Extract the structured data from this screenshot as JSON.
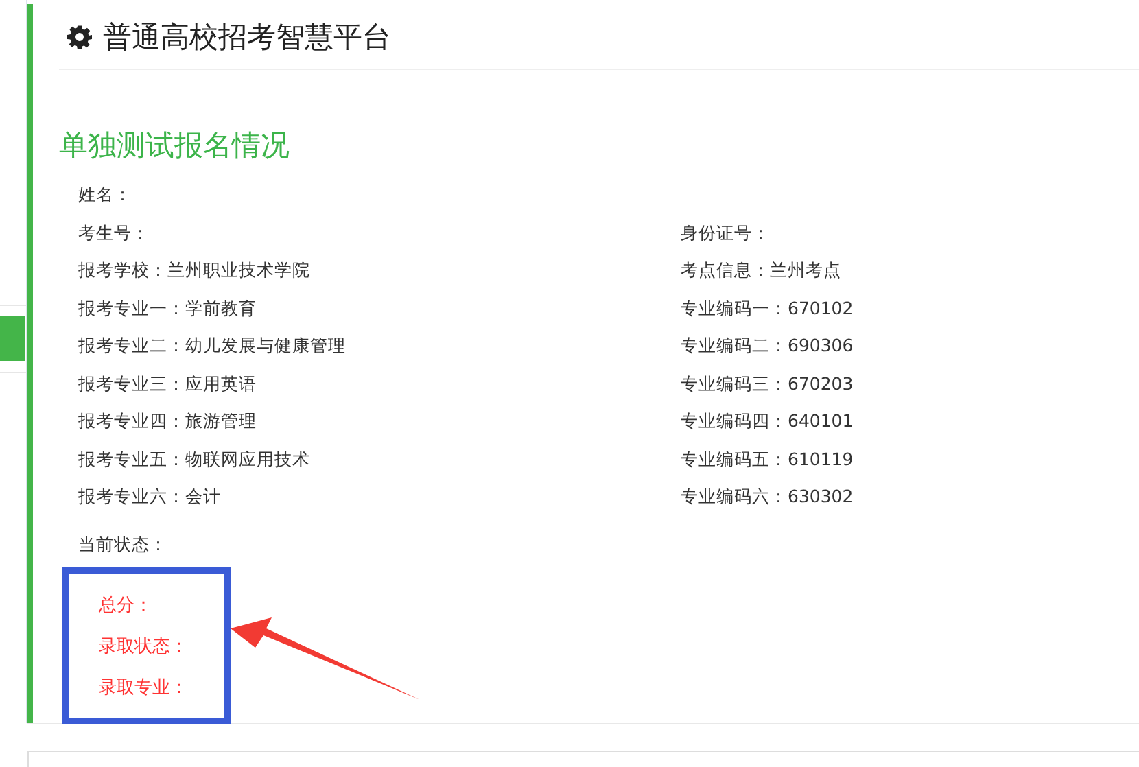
{
  "header": {
    "title": "普通高校招考智慧平台"
  },
  "section_title": "单独测试报名情况",
  "info_rows": [
    {
      "cells": [
        "姓名："
      ]
    },
    {
      "cells": [
        "考生号：",
        "身份证号："
      ]
    },
    {
      "cells": [
        "报考学校：兰州职业技术学院",
        "考点信息：兰州考点"
      ]
    },
    {
      "cells": [
        "报考专业一：学前教育",
        "专业编码一：670102"
      ]
    },
    {
      "cells": [
        "报考专业二：幼儿发展与健康管理",
        "专业编码二：690306"
      ]
    },
    {
      "cells": [
        "报考专业三：应用英语",
        "专业编码三：670203"
      ]
    },
    {
      "cells": [
        "报考专业四：旅游管理",
        "专业编码四：640101"
      ]
    },
    {
      "cells": [
        "报考专业五：物联网应用技术",
        "专业编码五：610119"
      ]
    },
    {
      "cells": [
        "报考专业六：会计",
        "专业编码六：630302"
      ]
    }
  ],
  "status_label": "当前状态：",
  "results": [
    "总分：",
    "录取状态：",
    "录取专业："
  ]
}
